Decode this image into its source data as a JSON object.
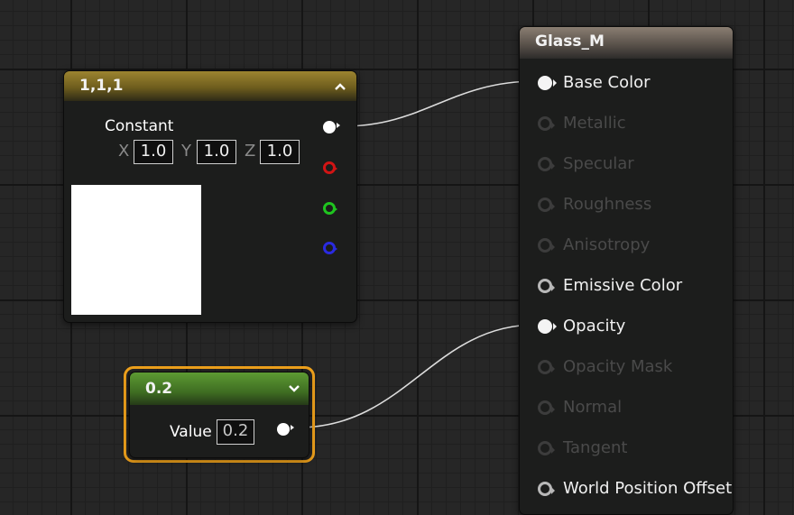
{
  "constant_node": {
    "title": "1,1,1",
    "label": "Constant",
    "x_label": "X",
    "x_value": "1.0",
    "y_label": "Y",
    "y_value": "1.0",
    "z_label": "Z",
    "z_value": "1.0",
    "header_color": "#8a7426",
    "preview_color": "#ffffff",
    "output_colors": [
      "#ffffff",
      "#d11414",
      "#1fc41f",
      "#2a2ae0"
    ]
  },
  "scalar_node": {
    "title": "0.2",
    "value_label": "Value",
    "value": "0.2",
    "header_color": "#4f8a2b",
    "selection_color": "#f0a21c"
  },
  "material_node": {
    "title": "Glass_M",
    "pins": [
      {
        "label": "Base Color",
        "state": "connected"
      },
      {
        "label": "Metallic",
        "state": "disabled"
      },
      {
        "label": "Specular",
        "state": "disabled"
      },
      {
        "label": "Roughness",
        "state": "disabled"
      },
      {
        "label": "Anisotropy",
        "state": "disabled"
      },
      {
        "label": "Emissive Color",
        "state": "enabled"
      },
      {
        "label": "Opacity",
        "state": "connected"
      },
      {
        "label": "Opacity Mask",
        "state": "disabled"
      },
      {
        "label": "Normal",
        "state": "disabled"
      },
      {
        "label": "Tangent",
        "state": "disabled"
      },
      {
        "label": "World Position Offset",
        "state": "enabled"
      }
    ]
  }
}
